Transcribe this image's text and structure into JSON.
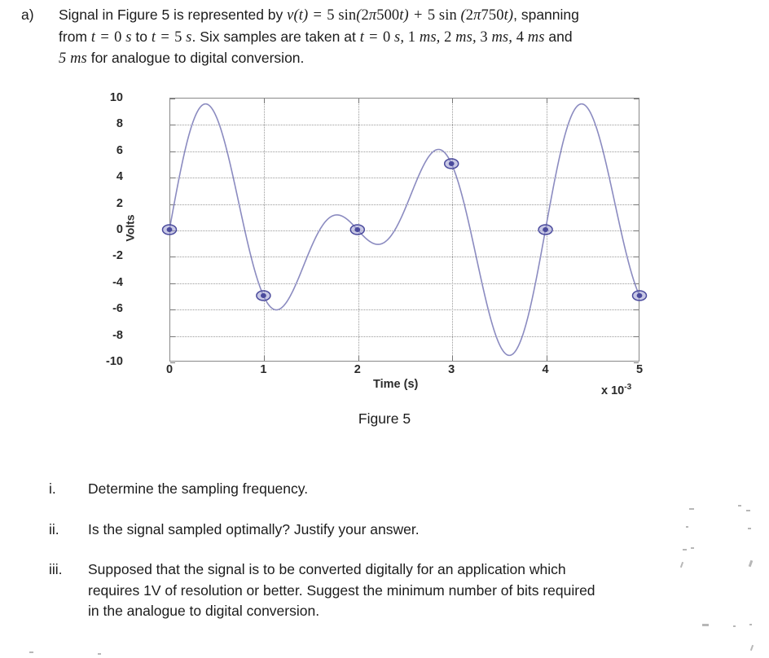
{
  "question": {
    "marker": "a)",
    "line1_pre": "Signal in Figure 5 is represented by ",
    "equation": "v(t) = 5 sin(2π500t) + 5 sin (2π750t)",
    "line1_post": ", spanning",
    "line2_pre": "from ",
    "line2_range": "t = 0 s",
    "line2_mid": " to ",
    "line2_range2": "t = 5 s",
    "line2_post": ". Six samples are taken at ",
    "line2_samples": "t = 0 s, 1 ms, 2 ms, 3 ms, 4 ms",
    "line2_end": " and",
    "line3_unit": "5 ms",
    "line3_post": " for analogue to digital conversion."
  },
  "figure": {
    "caption": "Figure 5",
    "x_axis_title": "Time (s)",
    "y_axis_title": "Volts",
    "x_exponent_prefix": "x 10",
    "x_exponent_power": "-3"
  },
  "chart_data": {
    "type": "line",
    "title": "Figure 5",
    "xlabel": "Time (s)",
    "ylabel": "Volts",
    "x_scale_note": "x 10^-3",
    "xlim": [
      0,
      5
    ],
    "ylim": [
      -10,
      10
    ],
    "xticks": [
      0,
      1,
      2,
      3,
      4,
      5
    ],
    "yticks": [
      10,
      8,
      6,
      4,
      2,
      0,
      -2,
      -4,
      -6,
      -8,
      -10
    ],
    "xtick_labels": [
      "0",
      "1",
      "2",
      "3",
      "4",
      "5"
    ],
    "ytick_labels": [
      "10",
      "8",
      "6",
      "4",
      "2",
      "0",
      "-2",
      "-4",
      "-6",
      "-8",
      "-10"
    ],
    "grid": true,
    "legend": false,
    "line_color": "#8b8bc0",
    "marker_color": "#4a4a9c",
    "marker_fill": "#9a9ad0",
    "equation": "v(t) = 5 sin(2*pi*500*t) + 5 sin(2*pi*750*t)",
    "series": [
      {
        "name": "v(t)",
        "type": "continuous",
        "amplitude_terms": [
          {
            "amplitude": 5,
            "frequency_hz": 500
          },
          {
            "amplitude": 5,
            "frequency_hz": 750
          }
        ]
      },
      {
        "name": "samples",
        "type": "scatter",
        "x_ms": [
          0,
          1,
          2,
          3,
          4,
          5
        ],
        "values": [
          0,
          -5,
          0,
          5,
          0,
          -5
        ]
      }
    ]
  },
  "subquestions": [
    {
      "marker": "i.",
      "lines": [
        "Determine the sampling frequency."
      ]
    },
    {
      "marker": "ii.",
      "lines": [
        "Is the signal sampled optimally? Justify your answer."
      ]
    },
    {
      "marker": "iii.",
      "lines": [
        "Supposed that the signal is to be converted digitally for an application which",
        "requires 1V of resolution or better. Suggest the minimum number of bits required",
        "in the analogue to digital conversion."
      ]
    }
  ]
}
